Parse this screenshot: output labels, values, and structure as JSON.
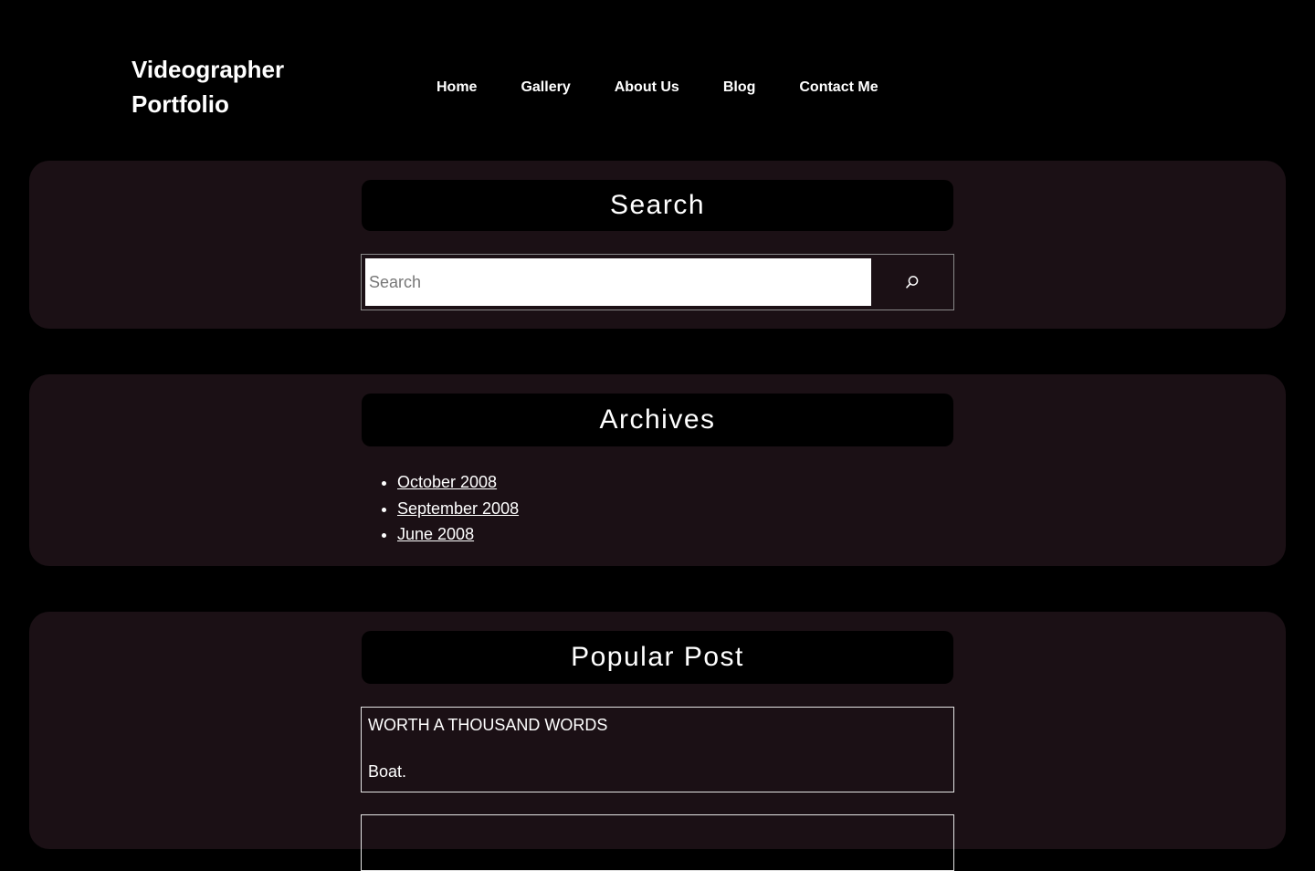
{
  "header": {
    "site_title": "Videographer Portfolio",
    "nav": [
      "Home",
      "Gallery",
      "About Us",
      "Blog",
      "Contact Me"
    ]
  },
  "search_widget": {
    "title": "Search",
    "placeholder": "Search",
    "value": "",
    "button_icon": "search-icon"
  },
  "archives_widget": {
    "title": "Archives",
    "items": [
      "October 2008",
      "September 2008",
      "June 2008"
    ]
  },
  "popular_widget": {
    "title": "Popular Post",
    "posts": [
      {
        "title": "WORTH A THOUSAND WORDS",
        "excerpt": "Boat."
      }
    ]
  },
  "colors": {
    "background": "#000000",
    "widget_background": "#1b1015",
    "title_bar": "#000000",
    "text": "#ffffff"
  }
}
